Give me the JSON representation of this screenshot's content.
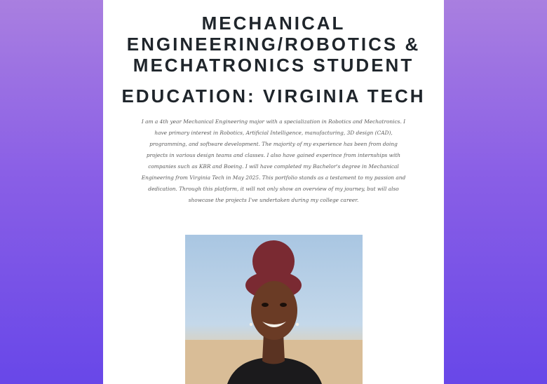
{
  "header": {
    "title": "MECHANICAL ENGINEERING/ROBOTICS & MECHATRONICS STUDENT",
    "subtitle": "EDUCATION: VIRGINIA TECH"
  },
  "bio": {
    "text": "I am a 4th year Mechanical Engineering major with a specialization in Robotics and Mechatronics. I have primary interest in Robotics, Artificial Intelligence, manufacturing, 3D design (CAD), programming, and software development. The majority of my experience has been from doing projects in various design teams and classes. I also have gained experince from internships with companies such as KBR and Boeing. I will have completed my Bachelor's degree in Mechanical Engineering from Virginia Tech in May 2025. This portfolio stands as a testament to my passion and dedication. Through this platform, it will not only show an overview of my journey, but will also showcase the projects I've undertaken during my college career."
  },
  "colors": {
    "background_top": "#a97fe0",
    "background_bottom": "#6847e8",
    "heading": "#1f252b"
  }
}
